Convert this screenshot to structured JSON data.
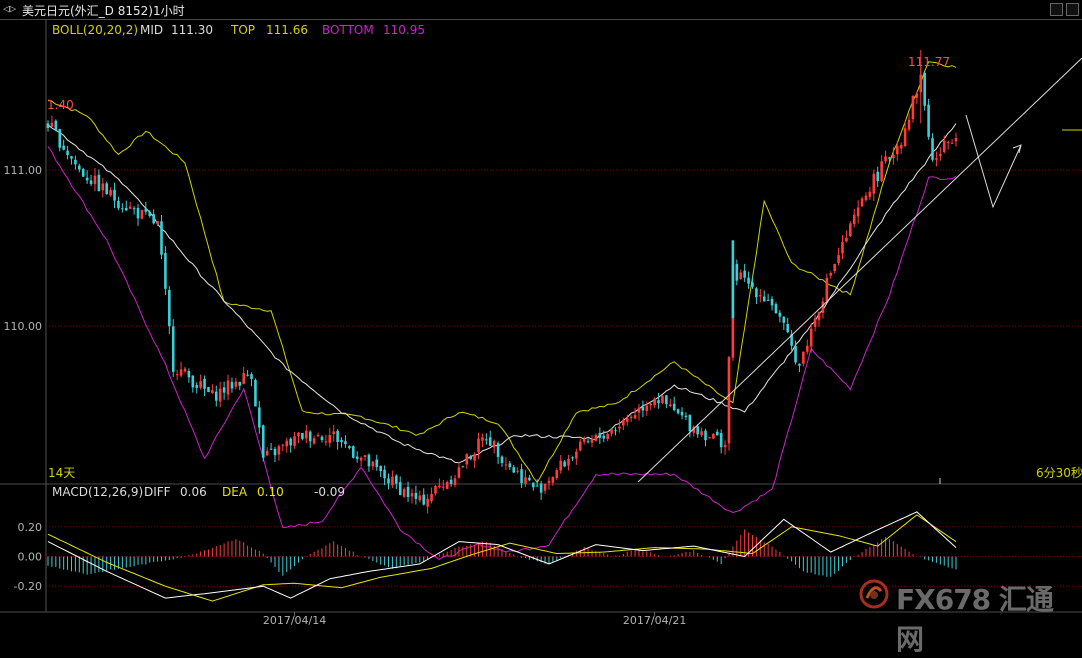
{
  "window": {
    "symbol_icon": "menu-arrows-icon",
    "symbol": "◁▷",
    "title": "美元日元(外汇_D 8152)1小时"
  },
  "boll_legend": {
    "name": "BOLL(20,20,2)",
    "mid_label": "MID",
    "mid_value": "111.30",
    "top_label": "TOP",
    "top_value": "111.66",
    "bottom_label": "BOTTOM",
    "bottom_value": "110.95"
  },
  "macd_legend": {
    "name": "MACD(12,26,9)",
    "diff_label": "DIFF",
    "diff_value": "0.06",
    "dea_label": "DEA",
    "dea_value": "0.10",
    "macd_value": "-0.09"
  },
  "annotations": {
    "high_label": "111.77",
    "left_label": "1.40",
    "days_label": "14天",
    "countdown": "6分30秒"
  },
  "watermark": {
    "text": "FX678 汇通网",
    "logo_icon": "fx678-logo-icon"
  },
  "colors": {
    "background": "#000000",
    "up_candle": "#ff3b3b",
    "down_candle": "#39d0d8",
    "boll_mid": "#e6e6e6",
    "boll_top": "#d2d200",
    "boll_bottom": "#cc22cc",
    "diff_line": "#ffffff",
    "dea_line": "#e6e600",
    "grid": "#7a0000",
    "axis_text": "#b4b4b4",
    "trendline": "#dcdcdc"
  },
  "chart_data": [
    {
      "type": "candlestick",
      "name": "price",
      "ylim": [
        109.0,
        111.95
      ],
      "y_ticks": [
        {
          "value": 111.0,
          "label": "111.00"
        },
        {
          "value": 110.0,
          "label": "110.00"
        }
      ],
      "x_labels": [
        {
          "index": 63,
          "label": "2017/04/14"
        },
        {
          "index": 155,
          "label": "2017/04/21"
        }
      ],
      "high_annotation": {
        "index": 223,
        "value": 111.77
      },
      "close_keypoints": [
        [
          0,
          111.3
        ],
        [
          8,
          111.0
        ],
        [
          18,
          110.8
        ],
        [
          28,
          110.65
        ],
        [
          32,
          109.75
        ],
        [
          42,
          109.55
        ],
        [
          52,
          109.7
        ],
        [
          55,
          109.15
        ],
        [
          65,
          109.3
        ],
        [
          73,
          109.3
        ],
        [
          85,
          109.05
        ],
        [
          95,
          108.87
        ],
        [
          104,
          109.05
        ],
        [
          112,
          109.3
        ],
        [
          118,
          109.1
        ],
        [
          125,
          108.95
        ],
        [
          135,
          109.2
        ],
        [
          145,
          109.35
        ],
        [
          155,
          109.55
        ],
        [
          165,
          109.35
        ],
        [
          173,
          109.25
        ],
        [
          175,
          110.35
        ],
        [
          185,
          110.15
        ],
        [
          192,
          109.75
        ],
        [
          200,
          110.35
        ],
        [
          210,
          110.9
        ],
        [
          218,
          111.2
        ],
        [
          223,
          111.6
        ],
        [
          226,
          111.05
        ],
        [
          232,
          111.25
        ]
      ],
      "overlay_keypoints": {
        "boll_mid": [
          [
            0,
            111.3
          ],
          [
            20,
            110.9
          ],
          [
            40,
            110.3
          ],
          [
            60,
            109.75
          ],
          [
            75,
            109.45
          ],
          [
            90,
            109.25
          ],
          [
            105,
            109.12
          ],
          [
            120,
            109.3
          ],
          [
            140,
            109.28
          ],
          [
            160,
            109.62
          ],
          [
            178,
            109.45
          ],
          [
            195,
            110.0
          ],
          [
            215,
            110.75
          ],
          [
            232,
            111.3
          ]
        ],
        "boll_top": [
          [
            0,
            111.45
          ],
          [
            10,
            111.35
          ],
          [
            18,
            111.1
          ],
          [
            25,
            111.25
          ],
          [
            35,
            111.05
          ],
          [
            45,
            110.15
          ],
          [
            57,
            110.1
          ],
          [
            65,
            109.45
          ],
          [
            80,
            109.42
          ],
          [
            95,
            109.3
          ],
          [
            105,
            109.45
          ],
          [
            115,
            109.38
          ],
          [
            125,
            109.0
          ],
          [
            135,
            109.45
          ],
          [
            145,
            109.5
          ],
          [
            160,
            109.77
          ],
          [
            175,
            109.5
          ],
          [
            183,
            110.8
          ],
          [
            190,
            110.4
          ],
          [
            205,
            110.2
          ],
          [
            215,
            111.05
          ],
          [
            225,
            111.7
          ],
          [
            232,
            111.66
          ]
        ],
        "boll_bottom": [
          [
            0,
            111.15
          ],
          [
            15,
            110.55
          ],
          [
            30,
            109.75
          ],
          [
            40,
            109.15
          ],
          [
            50,
            109.6
          ],
          [
            60,
            108.7
          ],
          [
            70,
            108.75
          ],
          [
            80,
            109.1
          ],
          [
            90,
            108.7
          ],
          [
            100,
            108.5
          ],
          [
            110,
            108.6
          ],
          [
            118,
            108.55
          ],
          [
            128,
            108.6
          ],
          [
            140,
            109.05
          ],
          [
            160,
            109.05
          ],
          [
            175,
            108.8
          ],
          [
            185,
            108.95
          ],
          [
            195,
            109.85
          ],
          [
            205,
            109.6
          ],
          [
            215,
            110.2
          ],
          [
            225,
            110.95
          ],
          [
            232,
            110.95
          ]
        ]
      }
    },
    {
      "type": "bar",
      "name": "macd",
      "ylim": [
        -0.36,
        0.36
      ],
      "y_ticks": [
        {
          "value": 0.2,
          "label": "0.20"
        },
        {
          "value": 0.0,
          "label": "0.00"
        },
        {
          "value": -0.2,
          "label": "-0.20"
        }
      ],
      "hist_keypoints": [
        [
          0,
          -0.06
        ],
        [
          10,
          -0.12
        ],
        [
          25,
          -0.05
        ],
        [
          35,
          0.0
        ],
        [
          42,
          0.06
        ],
        [
          48,
          0.12
        ],
        [
          55,
          0.02
        ],
        [
          60,
          -0.13
        ],
        [
          66,
          0.0
        ],
        [
          73,
          0.1
        ],
        [
          80,
          0.0
        ],
        [
          88,
          -0.08
        ],
        [
          96,
          -0.03
        ],
        [
          104,
          0.06
        ],
        [
          112,
          0.1
        ],
        [
          120,
          0.0
        ],
        [
          128,
          -0.05
        ],
        [
          137,
          0.06
        ],
        [
          145,
          0.0
        ],
        [
          150,
          0.05
        ],
        [
          158,
          0.0
        ],
        [
          165,
          0.04
        ],
        [
          172,
          -0.05
        ],
        [
          178,
          0.18
        ],
        [
          186,
          0.05
        ],
        [
          193,
          -0.1
        ],
        [
          200,
          -0.14
        ],
        [
          206,
          0.0
        ],
        [
          214,
          0.13
        ],
        [
          222,
          0.0
        ],
        [
          232,
          -0.09
        ]
      ],
      "diff_keypoints": [
        [
          0,
          0.1
        ],
        [
          15,
          -0.1
        ],
        [
          30,
          -0.28
        ],
        [
          40,
          -0.25
        ],
        [
          55,
          -0.2
        ],
        [
          62,
          -0.28
        ],
        [
          72,
          -0.15
        ],
        [
          82,
          -0.1
        ],
        [
          95,
          -0.05
        ],
        [
          105,
          0.1
        ],
        [
          115,
          0.08
        ],
        [
          128,
          -0.05
        ],
        [
          140,
          0.08
        ],
        [
          152,
          0.04
        ],
        [
          165,
          0.07
        ],
        [
          178,
          0.0
        ],
        [
          188,
          0.25
        ],
        [
          200,
          0.03
        ],
        [
          212,
          0.18
        ],
        [
          222,
          0.3
        ],
        [
          232,
          0.06
        ]
      ],
      "dea_keypoints": [
        [
          0,
          0.15
        ],
        [
          15,
          -0.04
        ],
        [
          30,
          -0.2
        ],
        [
          42,
          -0.3
        ],
        [
          55,
          -0.19
        ],
        [
          63,
          -0.18
        ],
        [
          75,
          -0.21
        ],
        [
          85,
          -0.14
        ],
        [
          98,
          -0.08
        ],
        [
          108,
          0.01
        ],
        [
          118,
          0.09
        ],
        [
          130,
          0.02
        ],
        [
          142,
          0.03
        ],
        [
          155,
          0.06
        ],
        [
          168,
          0.05
        ],
        [
          180,
          0.02
        ],
        [
          190,
          0.2
        ],
        [
          202,
          0.14
        ],
        [
          212,
          0.07
        ],
        [
          222,
          0.28
        ],
        [
          232,
          0.1
        ]
      ]
    }
  ]
}
